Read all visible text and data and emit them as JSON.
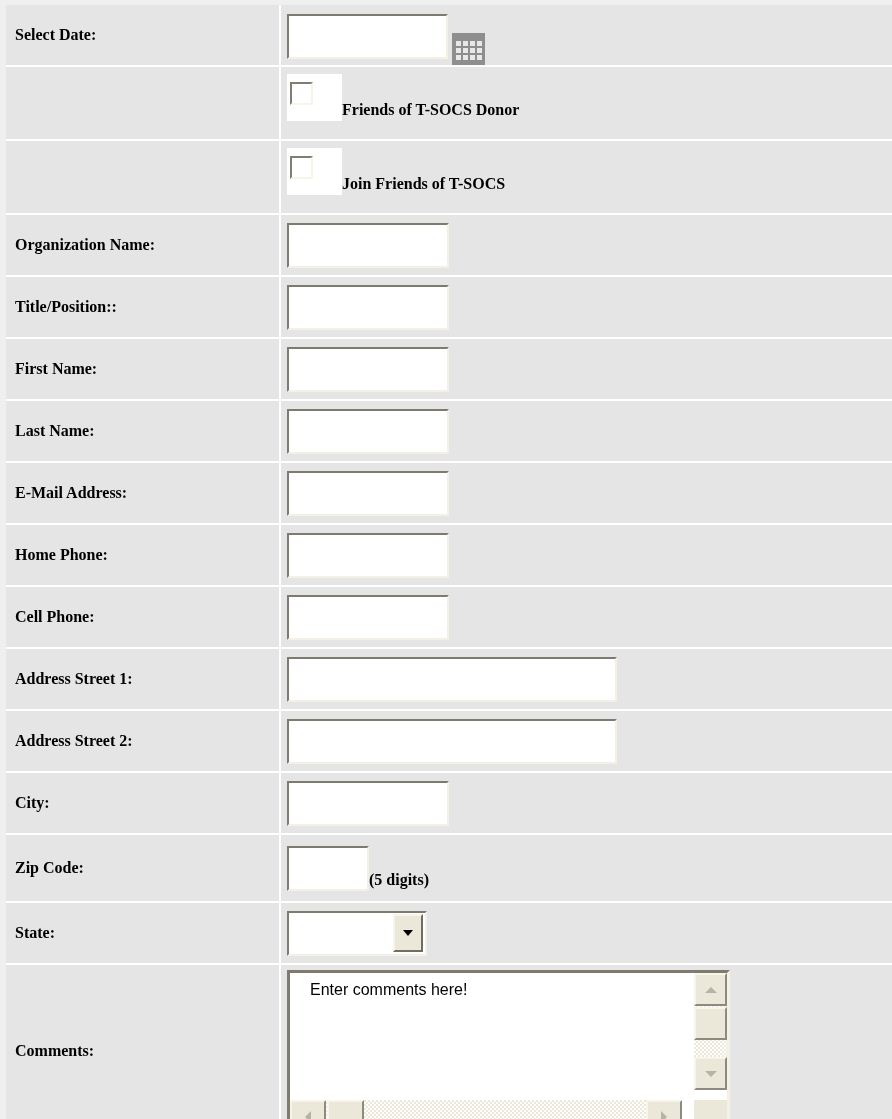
{
  "form": {
    "rows": [
      {
        "kind": "date",
        "label": "Select Date:",
        "value": ""
      },
      {
        "kind": "checkbox",
        "text": "Friends of T-SOCS Donor",
        "checked": false
      },
      {
        "kind": "checkbox",
        "text": "Join Friends of T-SOCS",
        "checked": false
      },
      {
        "kind": "text",
        "label": "Organization Name:"
      },
      {
        "kind": "text",
        "label": "Title/Position::"
      },
      {
        "kind": "text",
        "label": "First Name:"
      },
      {
        "kind": "text",
        "label": "Last Name:"
      },
      {
        "kind": "text",
        "label": "E-Mail Address:"
      },
      {
        "kind": "text",
        "label": "Home Phone:"
      },
      {
        "kind": "text",
        "label": "Cell Phone:"
      },
      {
        "kind": "wide_text",
        "label": "Address Street 1:"
      },
      {
        "kind": "wide_text",
        "label": "Address Street 2:"
      },
      {
        "kind": "text",
        "label": "City:"
      },
      {
        "kind": "zip",
        "label": "Zip Code:",
        "hint": "(5 digits)"
      },
      {
        "kind": "select",
        "label": "State:"
      },
      {
        "kind": "textarea",
        "label": "Comments:",
        "value": "Enter comments here!"
      }
    ]
  }
}
